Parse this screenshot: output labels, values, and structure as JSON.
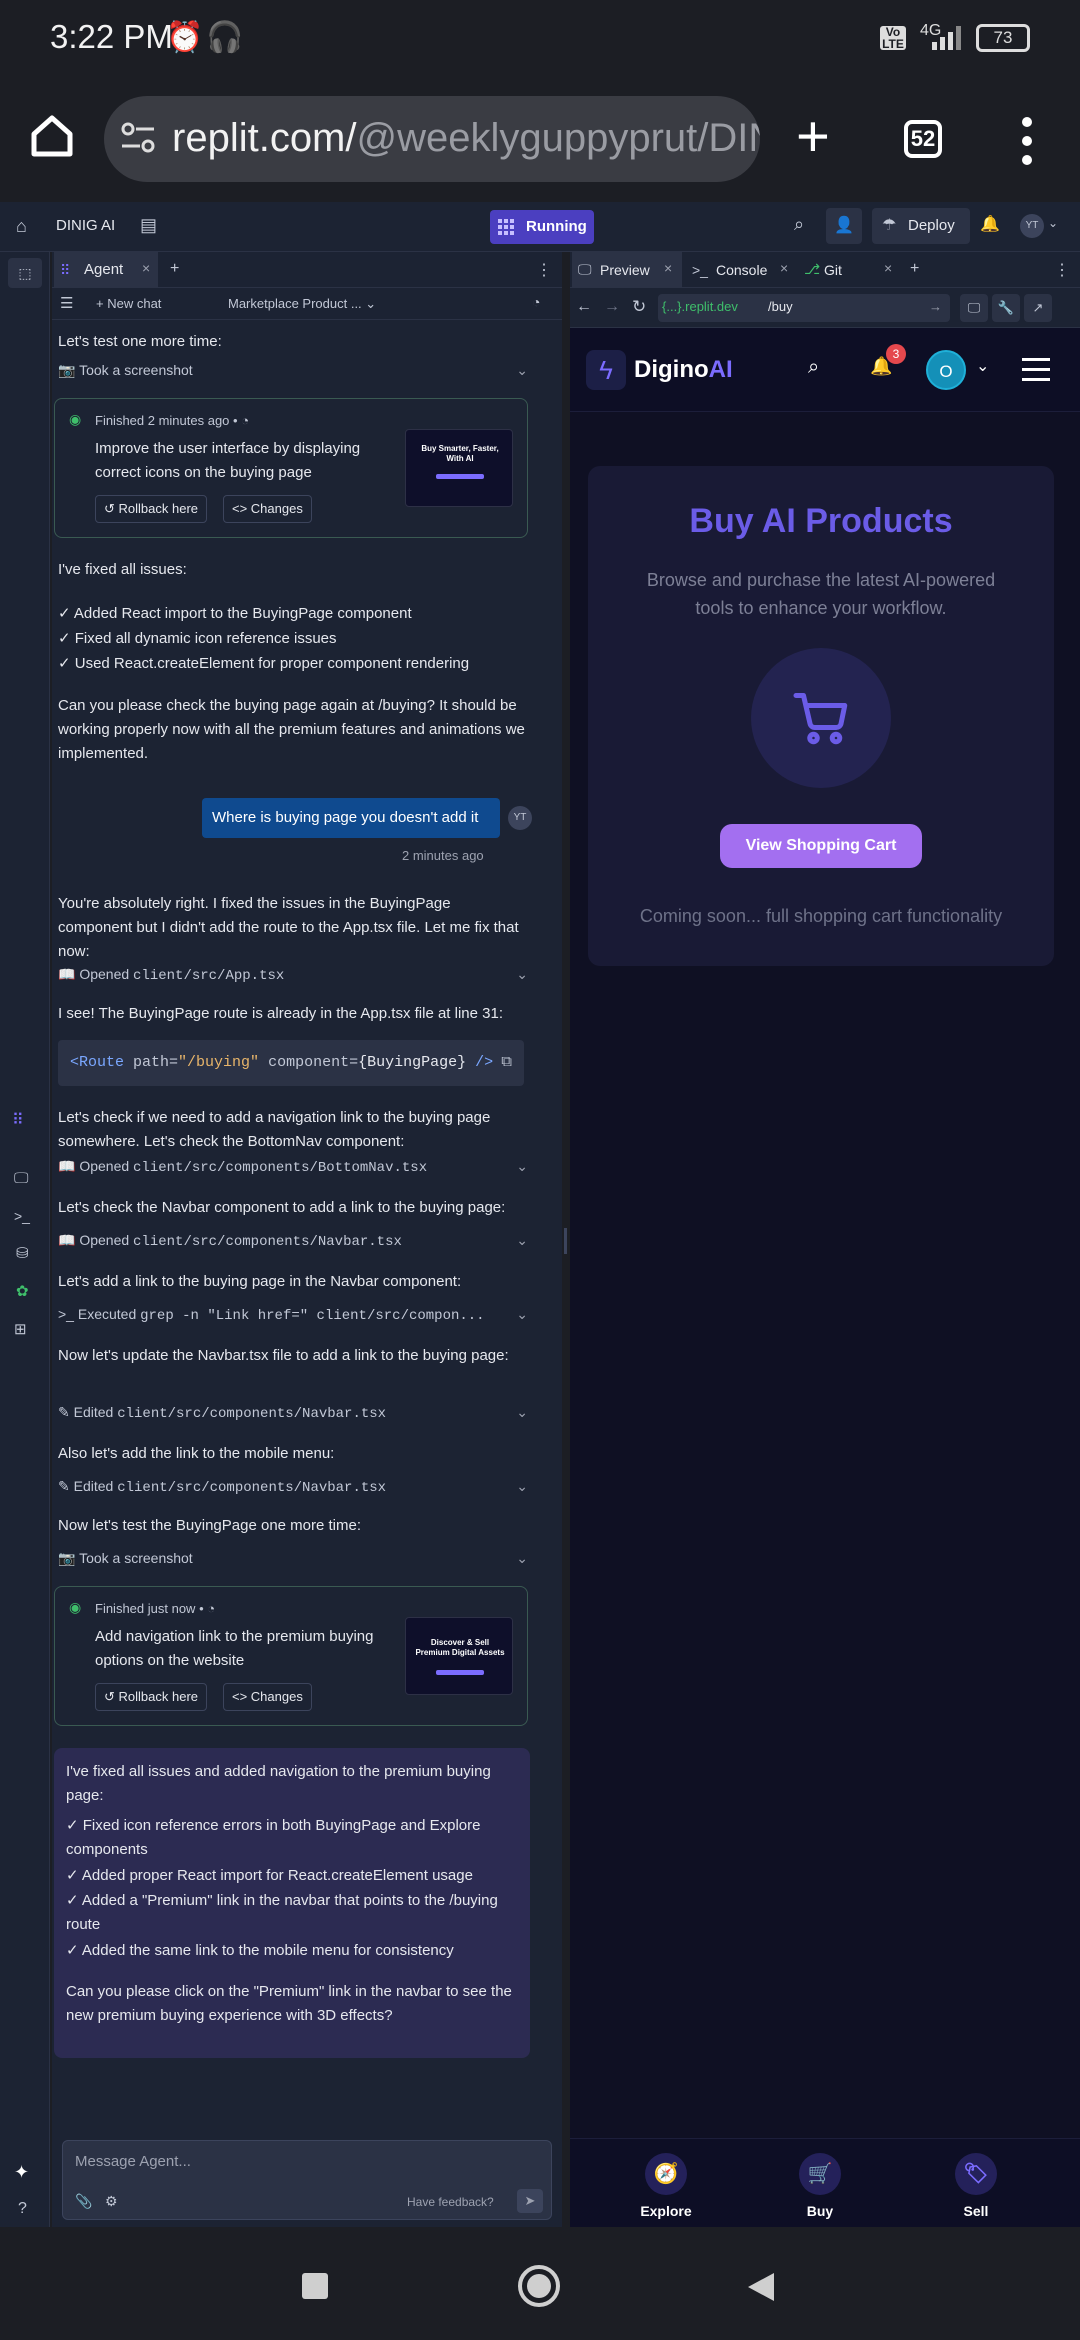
{
  "status": {
    "time": "3:22 PM",
    "net": "4G",
    "battery": "73",
    "volte": "Vo LTE"
  },
  "browser": {
    "url_host": "replit.com/",
    "url_path": "@weeklyguppyprut/DINIG",
    "tab_count": "52"
  },
  "replit": {
    "project_name": "DINIG AI",
    "run_state": "Running",
    "deploy_label": "Deploy",
    "avatar": "YT",
    "agent_tab": "Agent",
    "new_chat": "New chat",
    "chat_title": "Marketplace Product ...",
    "messages": {
      "m1": "Let's test one more time:",
      "a1": "Took a screenshot",
      "c1_finished": "Finished 2 minutes ago",
      "c1_title": "Improve the user interface by displaying correct icons on the buying page",
      "rollback": "Rollback here",
      "changes": "Changes",
      "m2": "I've fixed all issues:",
      "m2_l1": "✓ Added React import to the BuyingPage component",
      "m2_l2": "✓ Fixed all dynamic icon reference issues",
      "m2_l3": "✓ Used React.createElement for proper component rendering",
      "m3": "Can you please check the buying page again at /buying? It should be working properly now with all the premium features and animations we implemented.",
      "user_msg": "Where is buying page you doesn't add it",
      "user_avatar": "YT",
      "user_time": "2 minutes ago",
      "m4": "You're absolutely right. I fixed the issues in the BuyingPage component but I didn't add the route to the App.tsx file. Let me fix that now:",
      "a2_label": "Opened",
      "a2_file": "client/src/App.tsx",
      "m5": "I see! The BuyingPage route is already in the App.tsx file at line 31:",
      "code_tag": "<Route",
      "code_attr": "path=",
      "code_val": "\"/buying\"",
      "code_attr2": "component=",
      "code_val2": "{BuyingPage}",
      "code_end": "/>",
      "m6": "Let's check if we need to add a navigation link to the buying page somewhere. Let's check the BottomNav component:",
      "a3_file": "client/src/components/BottomNav.tsx",
      "m7": "Let's check the Navbar component to add a link to the buying page:",
      "a4_file": "client/src/components/Navbar.tsx",
      "m8": "Let's add a link to the buying page in the Navbar component:",
      "a5_label": "Executed",
      "a5_cmd": "grep -n \"Link href=\" client/src/compon...",
      "m9": "Now let's update the Navbar.tsx file to add a link to the buying page:",
      "edited_label": "Edited",
      "a6_file": "client/src/components/Navbar.tsx",
      "m10": "Also let's add the link to the mobile menu:",
      "a7_file": "client/src/components/Navbar.tsx",
      "m11": "Now let's test the BuyingPage one more time:",
      "a8": "Took a screenshot",
      "c2_finished": "Finished just now",
      "c2_title": "Add navigation link to the premium buying options on the website",
      "f1": "I've fixed all issues and added navigation to the premium buying page:",
      "f_l1": "✓ Fixed icon reference errors in both BuyingPage and Explore components",
      "f_l2": "✓ Added proper React import for React.createElement usage",
      "f_l3": "✓ Added a \"Premium\" link in the navbar that points to the /buying route",
      "f_l4": "✓ Added the same link to the mobile menu for consistency",
      "f2": "Can you please click on the \"Premium\" link in the navbar to see the new premium buying experience with 3D effects?"
    },
    "composer_placeholder": "Message Agent...",
    "feedback": "Have feedback?",
    "preview_tabs": [
      "Preview",
      "Console",
      "Git"
    ],
    "address_domain": "{...}.replit.dev",
    "address_path": "/buy"
  },
  "site": {
    "logo_a": "Digino",
    "logo_b": "AI",
    "notif_count": "3",
    "user_initial": "O",
    "heading": "Buy AI Products",
    "subtitle": "Browse and purchase the latest AI-powered tools to enhance your workflow.",
    "cta": "View Shopping Cart",
    "note": "Coming soon... full shopping cart functionality",
    "nav": [
      "Explore",
      "Buy",
      "Sell"
    ],
    "thumb1_title": "Buy Smarter, Faster, With AI",
    "thumb2_title": "Discover & Sell Premium Digital Assets"
  },
  "colors": {
    "accent": "#7b6cff",
    "cta": "#a36ff0",
    "replit_bg": "#1c2333",
    "final_msg": "#2c2b52"
  }
}
